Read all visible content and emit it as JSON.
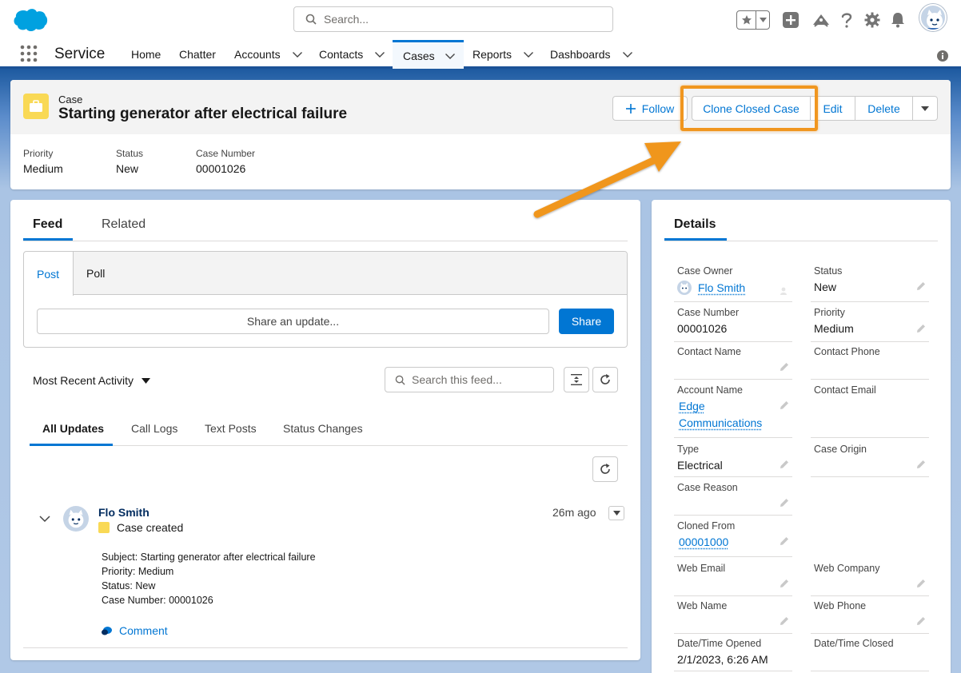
{
  "header": {
    "search_placeholder": "Search..."
  },
  "nav": {
    "app_name": "Service",
    "items": [
      "Home",
      "Chatter",
      "Accounts",
      "Contacts",
      "Cases",
      "Reports",
      "Dashboards"
    ],
    "active": "Cases"
  },
  "record": {
    "object_label": "Case",
    "title": "Starting generator after electrical failure",
    "actions": {
      "follow": "Follow",
      "clone_closed_case": "Clone Closed Case",
      "edit": "Edit",
      "delete": "Delete"
    },
    "highlights": [
      {
        "label": "Priority",
        "value": "Medium"
      },
      {
        "label": "Status",
        "value": "New"
      },
      {
        "label": "Case Number",
        "value": "00001026"
      }
    ]
  },
  "feed": {
    "tabs": [
      "Feed",
      "Related"
    ],
    "active_tab": "Feed",
    "publisher": {
      "tabs": [
        "Post",
        "Poll"
      ],
      "active": "Post",
      "input_placeholder": "Share an update...",
      "share_label": "Share"
    },
    "sort_label": "Most Recent Activity",
    "search_placeholder": "Search this feed...",
    "sub_tabs": [
      "All Updates",
      "Call Logs",
      "Text Posts",
      "Status Changes"
    ],
    "active_sub_tab": "All Updates",
    "item": {
      "author": "Flo Smith",
      "action": "Case created",
      "time": "26m ago",
      "lines": [
        {
          "label": "Subject:",
          "value": "Starting generator after electrical failure"
        },
        {
          "label": "Priority:",
          "value": "Medium"
        },
        {
          "label": "Status:",
          "value": "New"
        },
        {
          "label": "Case Number:",
          "value": "00001026"
        }
      ],
      "comment_label": "Comment"
    }
  },
  "details": {
    "tab": "Details",
    "fields": {
      "case_owner": {
        "label": "Case Owner",
        "value": "Flo Smith"
      },
      "status": {
        "label": "Status",
        "value": "New"
      },
      "case_number": {
        "label": "Case Number",
        "value": "00001026"
      },
      "priority": {
        "label": "Priority",
        "value": "Medium"
      },
      "contact_name": {
        "label": "Contact Name",
        "value": ""
      },
      "contact_phone": {
        "label": "Contact Phone",
        "value": ""
      },
      "account_name": {
        "label": "Account Name",
        "value_line1": "Edge",
        "value_line2": "Communications"
      },
      "contact_email": {
        "label": "Contact Email",
        "value": ""
      },
      "type": {
        "label": "Type",
        "value": "Electrical"
      },
      "case_origin": {
        "label": "Case Origin",
        "value": ""
      },
      "case_reason": {
        "label": "Case Reason",
        "value": ""
      },
      "cloned_from": {
        "label": "Cloned From",
        "value": "00001000"
      },
      "web_email": {
        "label": "Web Email",
        "value": ""
      },
      "web_company": {
        "label": "Web Company",
        "value": ""
      },
      "web_name": {
        "label": "Web Name",
        "value": ""
      },
      "web_phone": {
        "label": "Web Phone",
        "value": ""
      },
      "date_opened": {
        "label": "Date/Time Opened",
        "value": "2/1/2023, 6:26 AM"
      },
      "date_closed": {
        "label": "Date/Time Closed",
        "value": ""
      }
    }
  },
  "colors": {
    "brand_blue": "#0176d3",
    "highlight_orange": "#f0961f",
    "case_icon_yellow": "#f9d955",
    "nav_band_blue": "#1b5297"
  }
}
